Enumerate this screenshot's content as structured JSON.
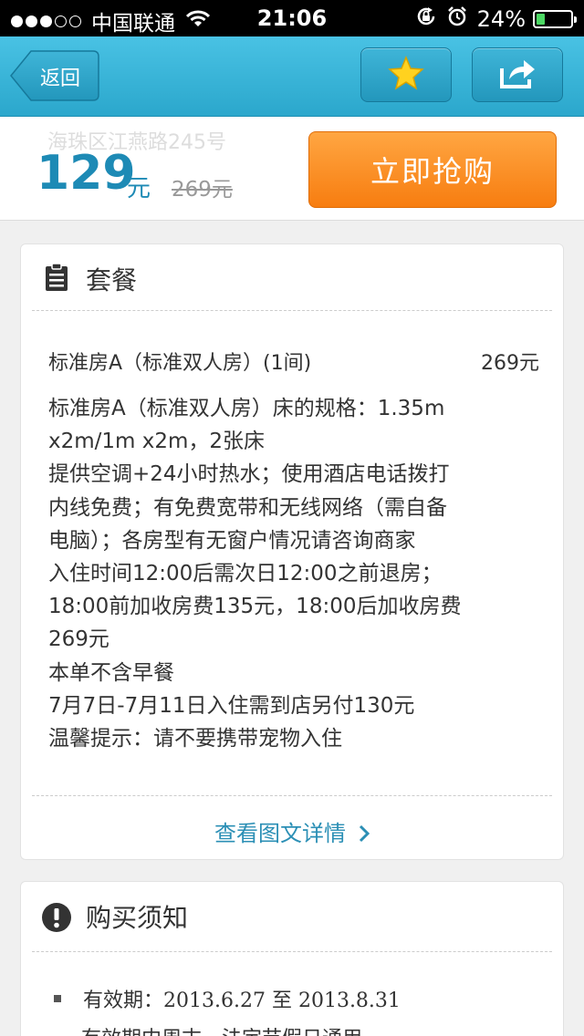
{
  "status_bar": {
    "carrier": "中国联通",
    "time": "21:06",
    "battery": "24%",
    "battery_level": 0.24,
    "signal_dots_filled": 3,
    "signal_dots_total": 5
  },
  "nav": {
    "back_label": "返回",
    "star_icon": "star-icon",
    "share_icon": "share-icon"
  },
  "deal": {
    "address": "海珠区江燕路245号",
    "price": "129",
    "price_unit": "元",
    "original_price": "269元",
    "buy_label": "立即抢购"
  },
  "package": {
    "title": "套餐",
    "item_name": "标准房A（标准双人房）(1间)",
    "item_price": "269元",
    "description_lines": [
      "标准房A（标准双人房）床的规格：1.35m",
      "x2m/1m x2m，2张床",
      "提供空调+24小时热水；使用酒店电话拨打",
      "内线免费；有免费宽带和无线网络（需自备",
      "电脑）；各房型有无窗户情况请咨询商家",
      "入住时间12:00后需次日12:00之前退房；",
      "18:00前加收房费135元，18:00后加收房费",
      "269元",
      "本单不含早餐",
      "7月7日-7月11日入住需到店另付130元",
      "温馨提示：请不要携带宠物入住"
    ],
    "detail_link": "查看图文详情"
  },
  "notice": {
    "title": "购买须知",
    "validity": "有效期：2013.6.27 至 2013.8.31",
    "partial_line": "有效期内周末、法定节假日通用"
  },
  "colors": {
    "nav": "#2ba7cc",
    "accent": "#1d8ab5",
    "buy_button": "#f77d10",
    "link": "#2b8fb5"
  }
}
